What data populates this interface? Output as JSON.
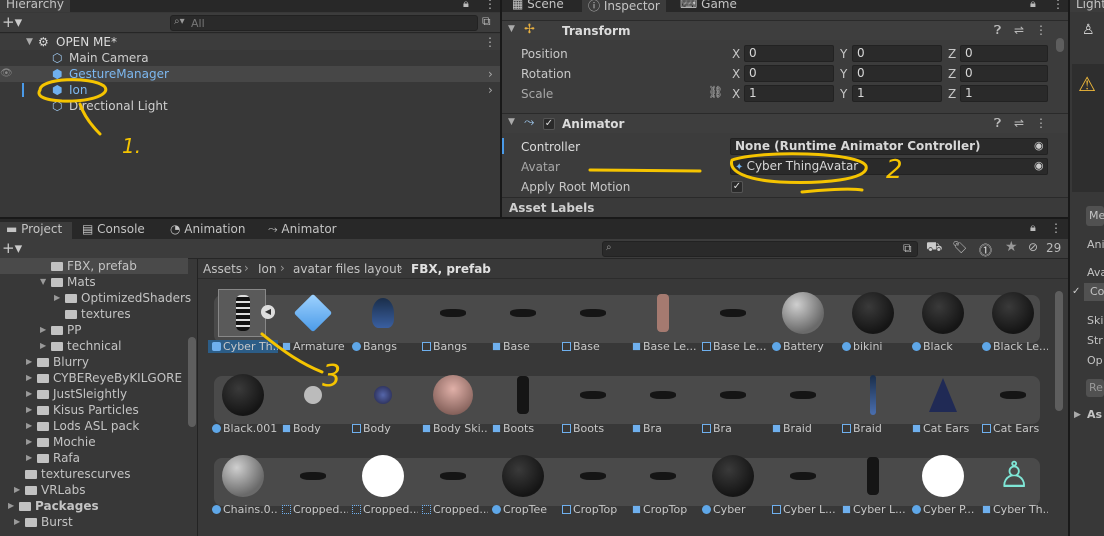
{
  "hierarchy": {
    "tab": "Hierarchy",
    "search_placeholder": "All",
    "scene": "OPEN ME*",
    "items": [
      {
        "label": "Main Camera"
      },
      {
        "label": "GestureManager"
      },
      {
        "label": "Ion"
      },
      {
        "label": "Directional Light"
      }
    ]
  },
  "inspector_tabs": {
    "scene": "Scene",
    "inspector": "Inspector",
    "game": "Game",
    "lighting": "Light"
  },
  "transform": {
    "title": "Transform",
    "position": {
      "label": "Position",
      "x": "0",
      "y": "0",
      "z": "0"
    },
    "rotation": {
      "label": "Rotation",
      "x": "0",
      "y": "0",
      "z": "0"
    },
    "scale": {
      "label": "Scale",
      "x": "1",
      "y": "1",
      "z": "1"
    },
    "axis_x": "X",
    "axis_y": "Y",
    "axis_z": "Z"
  },
  "animator": {
    "title": "Animator",
    "controller_label": "Controller",
    "controller_value": "None (Runtime Animator Controller)",
    "avatar_label": "Avatar",
    "avatar_value": "Cyber ThingAvatar",
    "apply_root_motion_label": "Apply Root Motion",
    "asset_labels": "Asset Labels"
  },
  "bottom_tabs": {
    "project": "Project",
    "console": "Console",
    "animation": "Animation",
    "animator": "Animator"
  },
  "project_tree": [
    {
      "label": "FBX, prefab",
      "indent": 3
    },
    {
      "label": "Mats",
      "indent": 3
    },
    {
      "label": "OptimizedShaders",
      "indent": 4
    },
    {
      "label": "textures",
      "indent": 4
    },
    {
      "label": "PP",
      "indent": 3
    },
    {
      "label": "technical",
      "indent": 3
    },
    {
      "label": "Blurry",
      "indent": 2
    },
    {
      "label": "CYBEReyeByKILGORE",
      "indent": 2
    },
    {
      "label": "JustSleightly",
      "indent": 2
    },
    {
      "label": "Kisus Particles",
      "indent": 2
    },
    {
      "label": "Lods ASL pack",
      "indent": 2
    },
    {
      "label": "Mochie",
      "indent": 2
    },
    {
      "label": "Rafa",
      "indent": 2
    },
    {
      "label": "texturescurves",
      "indent": 1
    },
    {
      "label": "VRLabs",
      "indent": 1
    },
    {
      "label": "Packages",
      "indent": 0
    },
    {
      "label": "Burst",
      "indent": 1
    }
  ],
  "breadcrumb": [
    "Assets",
    "Ion",
    "avatar files layout",
    "FBX, prefab"
  ],
  "hidden_count": "29",
  "rows": [
    [
      "Cyber Th...",
      "Armature",
      "Bangs",
      "Bangs",
      "Base",
      "Base",
      "Base Le...",
      "Base Le...",
      "Battery",
      "bikini",
      "Black",
      "Black Le..."
    ],
    [
      "Black.001",
      "Body",
      "Body",
      "Body Ski...",
      "Boots",
      "Boots",
      "Bra",
      "Bra",
      "Braid",
      "Braid",
      "Cat Ears",
      "Cat Ears"
    ],
    [
      "Chains.0...",
      "Cropped...",
      "Cropped...",
      "Cropped...",
      "CropTee",
      "CropTop",
      "CropTop",
      "Cyber",
      "Cyber L...",
      "Cyber L...",
      "Cyber P...",
      "Cyber Th..."
    ]
  ],
  "right_panel": {
    "items": [
      "Me",
      "Ani",
      "Ava",
      "Co",
      "Ski",
      "Str",
      "Op",
      "Re",
      "As"
    ]
  },
  "annotations": [
    "1.",
    "2",
    "3"
  ],
  "colors": {
    "selection": "#2c5d87",
    "accent_blue": "#6fb0ee",
    "highlight": "#f5c400"
  }
}
